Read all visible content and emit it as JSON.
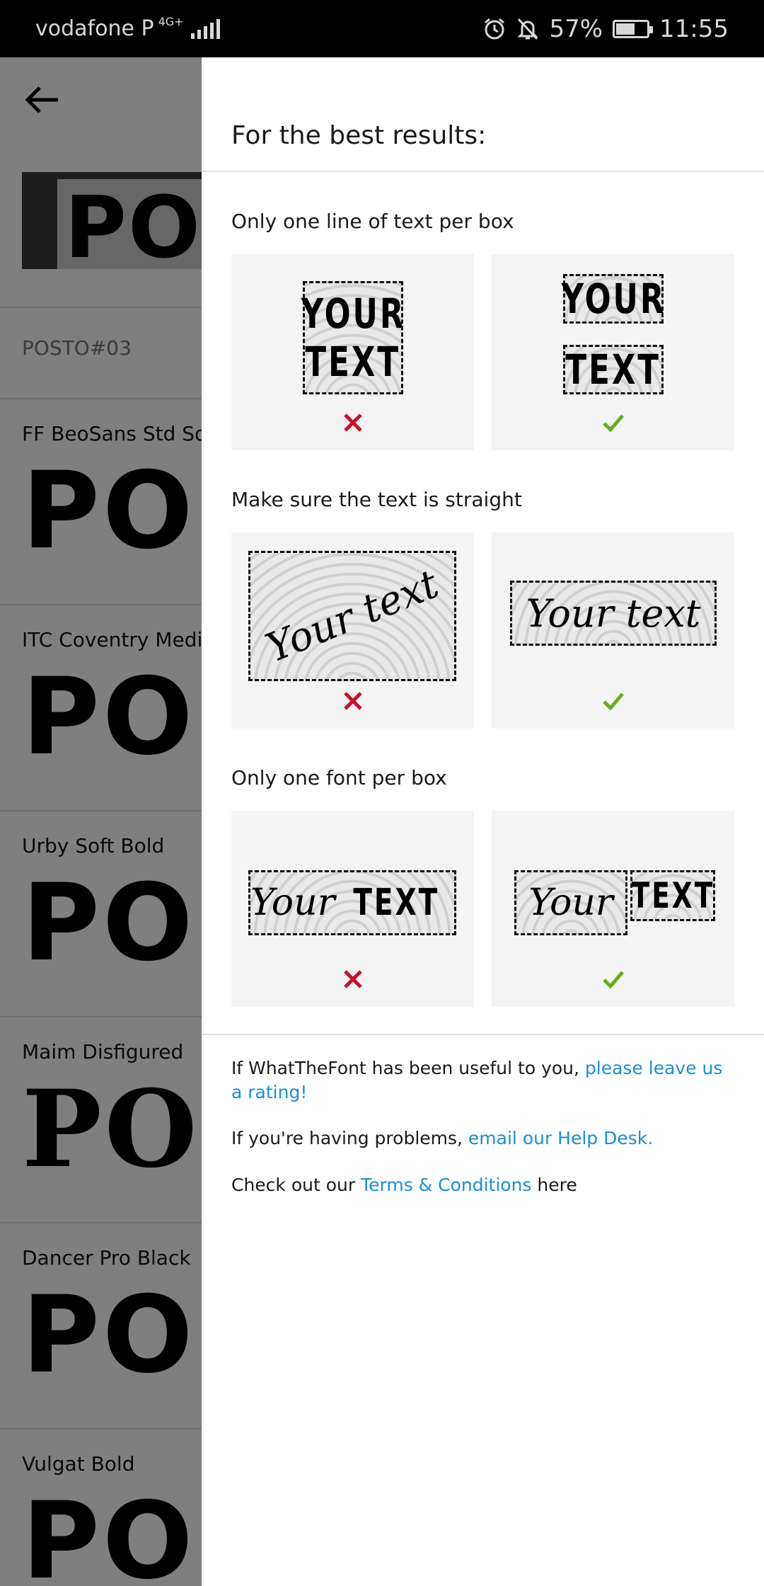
{
  "status_bar": {
    "carrier": "vodafone P",
    "network": "4G+",
    "battery": "57%",
    "time": "11:55"
  },
  "background": {
    "upload_name": "POSTO#03",
    "thumbnail_text": "POS",
    "fonts": [
      {
        "name": "FF BeoSans Std Sof",
        "sample": "POST"
      },
      {
        "name": "ITC Coventry Mediu",
        "sample": "POS"
      },
      {
        "name": "Urby Soft Bold",
        "sample": "POS"
      },
      {
        "name": "Maim Disfigured",
        "sample": "POST"
      },
      {
        "name": "Dancer Pro Black",
        "sample": "POS"
      },
      {
        "name": "Vulgat Bold",
        "sample": "POST"
      }
    ]
  },
  "drawer": {
    "title": "For the best results:",
    "sections": [
      {
        "title": "Only one line of text per box"
      },
      {
        "title": "Make sure the text is straight"
      },
      {
        "title": "Only one font per box"
      }
    ],
    "examples": {
      "your": "YOUR",
      "text": "TEXT",
      "your_text_script": "Your text",
      "your_script": "Your"
    },
    "footer": {
      "rate_prefix": "If WhatTheFont has been useful to you, ",
      "rate_link": "please leave us a rating!",
      "help_prefix": "If you're having problems, ",
      "help_link": "email our Help Desk.",
      "terms_prefix": "Check out our ",
      "terms_link": "Terms & Conditions",
      "terms_suffix": " here"
    }
  },
  "colors": {
    "wrong": "#c8102e",
    "right": "#6aab1f",
    "link": "#1a8fd1"
  }
}
